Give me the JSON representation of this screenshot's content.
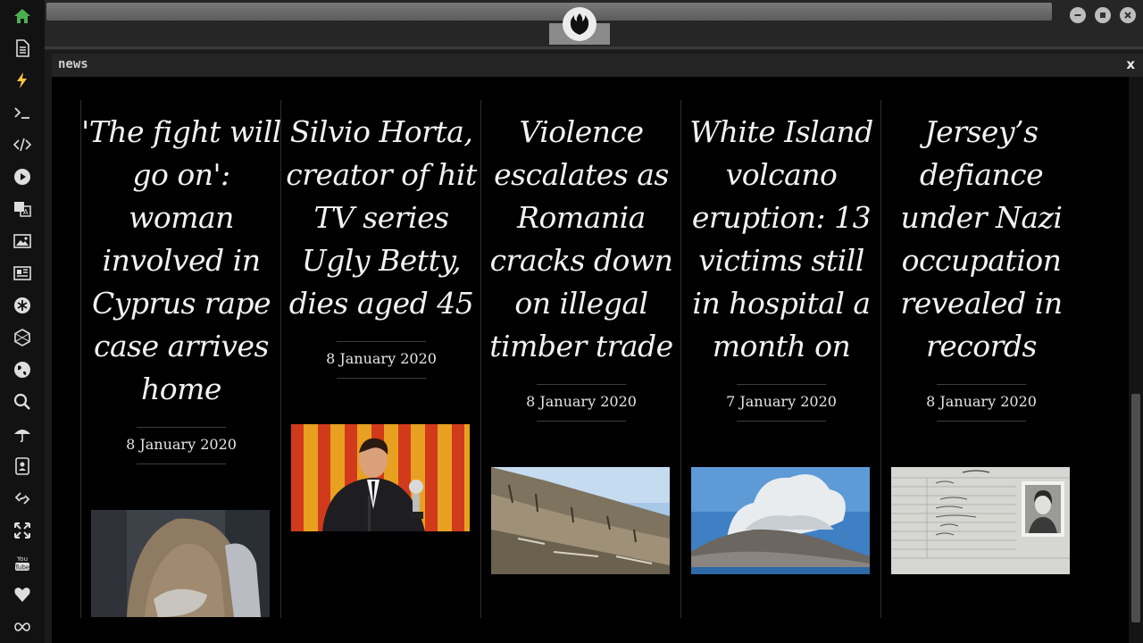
{
  "sidebar": {
    "icons": [
      "home-icon",
      "document-icon",
      "lightning-icon",
      "terminal-icon",
      "code-icon",
      "play-icon",
      "translate-icon",
      "image-icon",
      "newspaper-icon",
      "asterisk-icon",
      "hexagon-icon",
      "globe-icon",
      "search-icon",
      "umbrella-icon",
      "contact-card-icon",
      "link-icon",
      "expand-icon",
      "youtube-icon",
      "heart-icon",
      "infinity-icon"
    ],
    "youtube_label": "You\nTube",
    "active_color": "#4caf50",
    "lightning_color": "#f5c542"
  },
  "topbar": {
    "logo_icon": "rebel-alliance-icon",
    "window_buttons": [
      "minimize-icon",
      "maximize-icon",
      "close-icon"
    ]
  },
  "panel": {
    "title": "news",
    "close_label": "x"
  },
  "articles": [
    {
      "title": "'The fight will go on': woman involved in Cyprus rape case arrives home",
      "date": "8 January 2020",
      "image": "woman-hiding-face-photo"
    },
    {
      "title": "Silvio Horta, creator of hit TV series Ugly Betty, dies aged 45",
      "date": "8 January 2020",
      "image": "man-with-award-photo"
    },
    {
      "title": "Violence escalates as Romania cracks down on illegal timber trade",
      "date": "8 January 2020",
      "image": "logged-hillside-photo"
    },
    {
      "title": "White Island volcano eruption: 13 victims still in hospital a month on",
      "date": "7 January 2020",
      "image": "volcano-plume-photo"
    },
    {
      "title": "Jersey’s defiance under Nazi occupation revealed in records",
      "date": "8 January 2020",
      "image": "identity-card-photo"
    }
  ]
}
